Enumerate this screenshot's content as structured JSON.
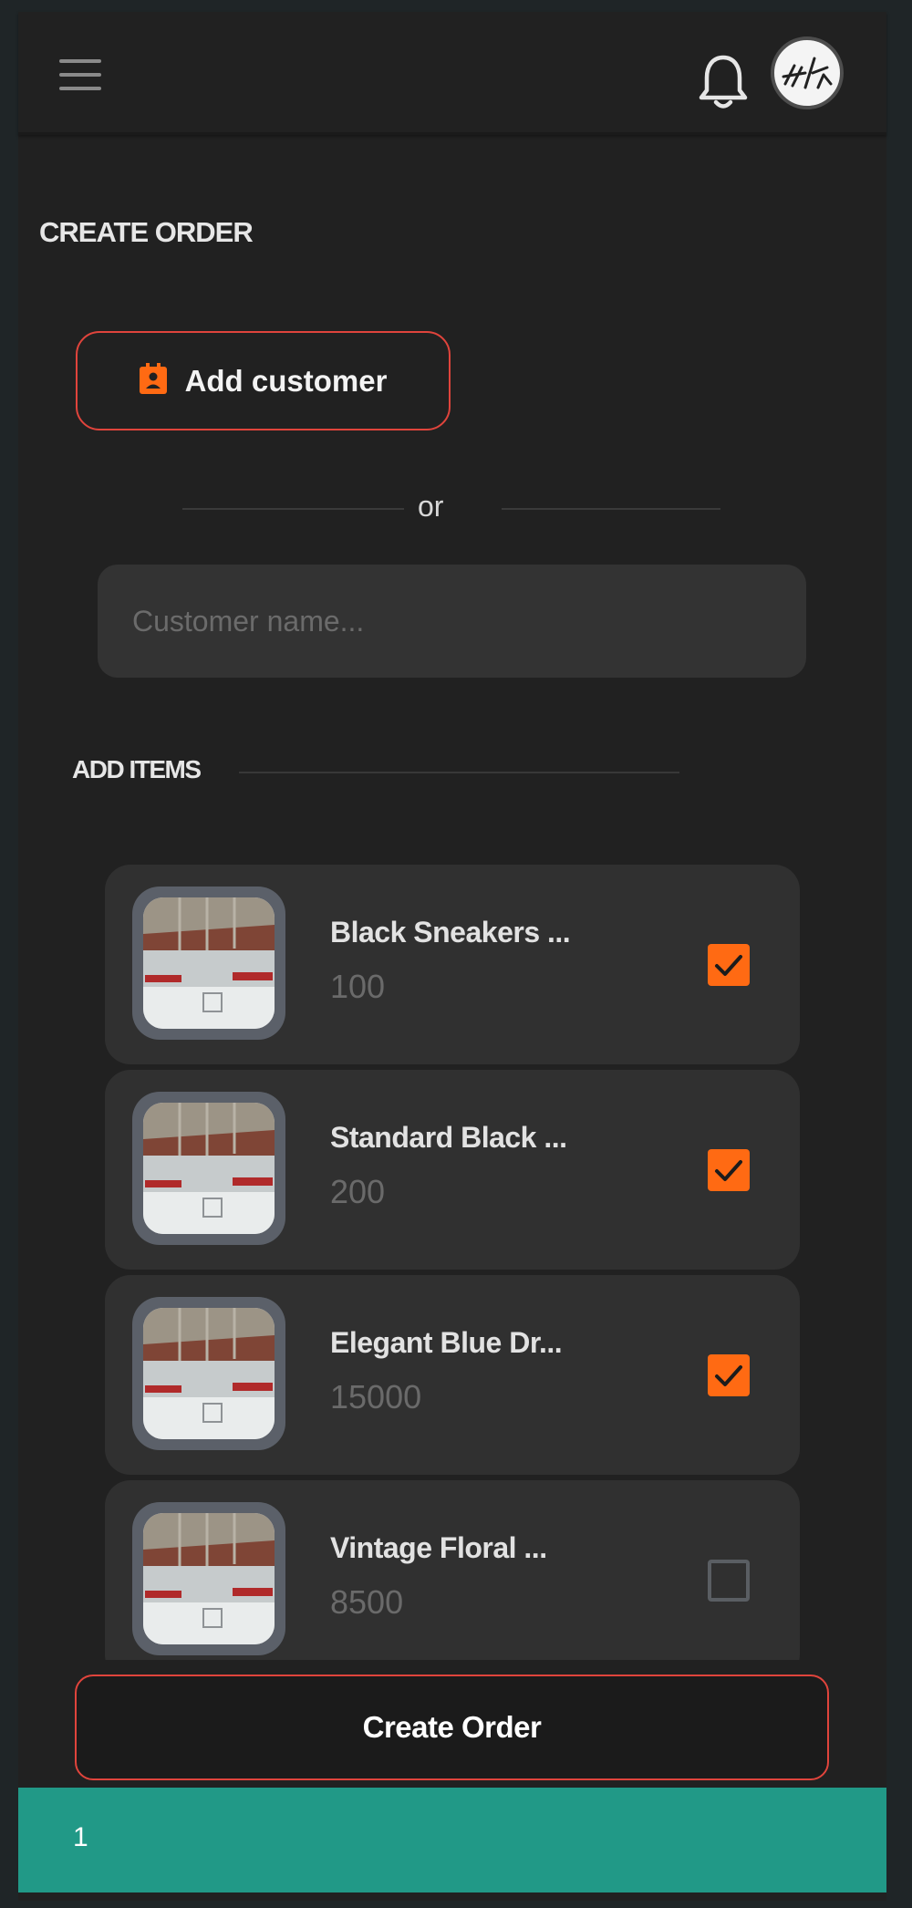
{
  "header": {
    "menu_icon": "hamburger-menu-icon",
    "notifications_icon": "bell-icon",
    "avatar_icon": "user-avatar"
  },
  "page": {
    "title": "CREATE ORDER"
  },
  "customer": {
    "add_button_label": "Add customer",
    "add_button_icon": "contact-card-icon",
    "divider_text": "or",
    "name_placeholder": "Customer name..."
  },
  "items_section": {
    "title": "ADD ITEMS",
    "items": [
      {
        "name": "Black Sneakers ...",
        "price": "100",
        "checked": true
      },
      {
        "name": "Standard Black ...",
        "price": "200",
        "checked": true
      },
      {
        "name": "Elegant Blue Dr...",
        "price": "15000",
        "checked": true
      },
      {
        "name": "Vintage Floral ...",
        "price": "8500",
        "checked": false
      }
    ]
  },
  "actions": {
    "create_order_label": "Create Order"
  },
  "footer": {
    "text": "1"
  },
  "colors": {
    "accent": "#ff6a13",
    "border_accent": "#e0443c",
    "footer_bg": "#219987",
    "background": "#212121",
    "card_bg": "#303030"
  }
}
